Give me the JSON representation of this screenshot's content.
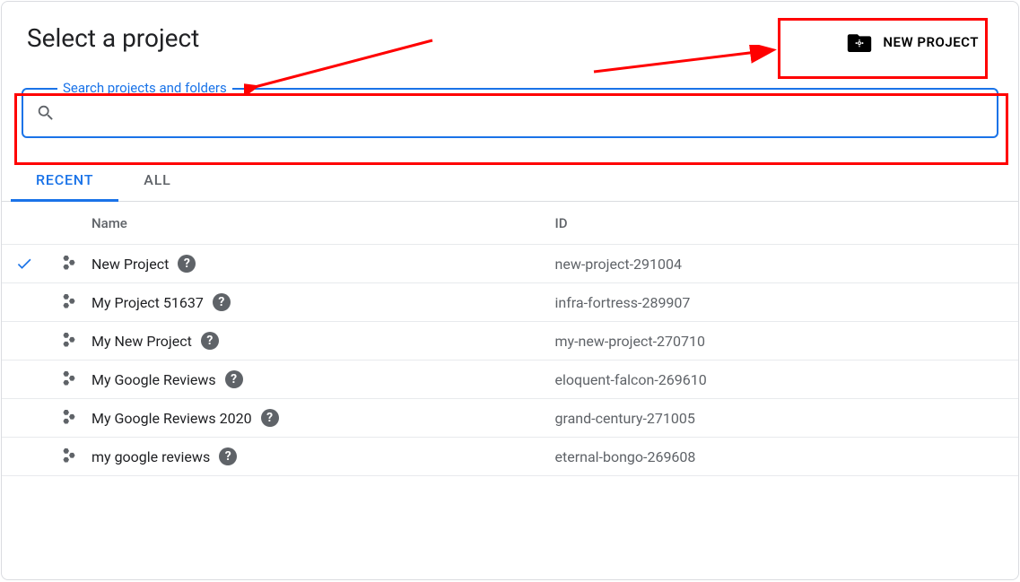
{
  "header": {
    "title": "Select a project",
    "new_project_label": "NEW PROJECT"
  },
  "search": {
    "placeholder": "",
    "value": "",
    "legend": "Search projects and folders"
  },
  "tabs": {
    "recent": "RECENT",
    "all": "ALL",
    "active": "recent"
  },
  "table": {
    "columns": {
      "name": "Name",
      "id": "ID"
    }
  },
  "projects": [
    {
      "selected": true,
      "name": "New Project",
      "id": "new-project-291004"
    },
    {
      "selected": false,
      "name": "My Project 51637",
      "id": "infra-fortress-289907"
    },
    {
      "selected": false,
      "name": "My New Project",
      "id": "my-new-project-270710"
    },
    {
      "selected": false,
      "name": "My Google Reviews",
      "id": "eloquent-falcon-269610"
    },
    {
      "selected": false,
      "name": "My Google Reviews 2020",
      "id": "grand-century-271005"
    },
    {
      "selected": false,
      "name": "my google reviews",
      "id": "eternal-bongo-269608"
    }
  ]
}
